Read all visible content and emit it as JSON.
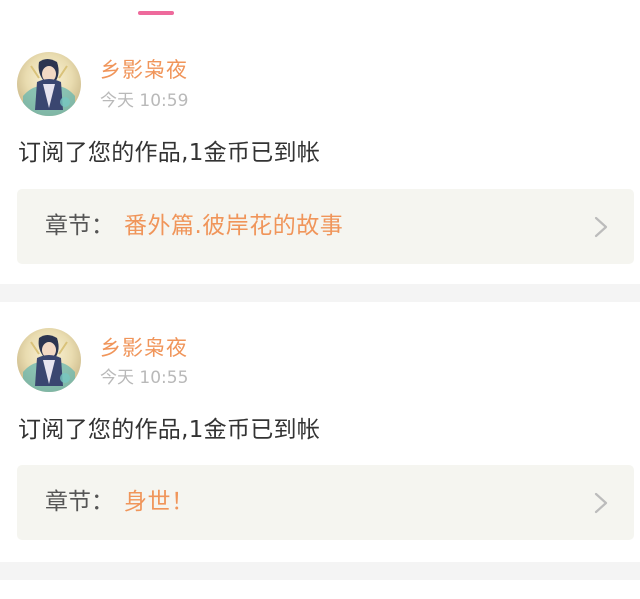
{
  "theme": {
    "accent_pink": "#ee6a9c",
    "accent_orange": "#f0955a"
  },
  "notifications": [
    {
      "avatar_icon": "anime-character-avatar",
      "username": "乡影枭夜",
      "time": "今天 10:59",
      "message": "订阅了您的作品,1金币已到帐",
      "chapter_label": "章节：",
      "chapter_title": "番外篇.彼岸花的故事"
    },
    {
      "avatar_icon": "anime-character-avatar",
      "username": "乡影枭夜",
      "time": "今天 10:55",
      "message": "订阅了您的作品,1金币已到帐",
      "chapter_label": "章节：",
      "chapter_title": "身世！"
    }
  ]
}
